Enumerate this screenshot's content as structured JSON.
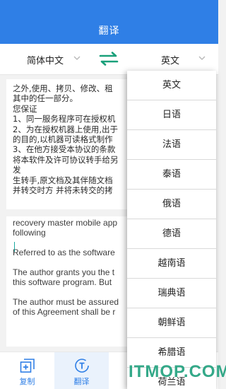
{
  "header": {
    "title": "翻译"
  },
  "language_bar": {
    "source_language": "简体中文",
    "target_language": "英文"
  },
  "source_panel": {
    "lines": [
      "之外,使用、拷贝、修改、租",
      "其中的任一部分。",
      "您保证",
      "1、同一服务程序可在授权机",
      "2、为在授权机器上使用,出于",
      "的目的,以机器可读格式制作",
      "3、在他方接受本协议的条款",
      "将本软件及许可协议转手给另",
      "发",
      "生转手,原文档及其伴随文档",
      "并转交时方 并将未转交的拷"
    ]
  },
  "target_panel": {
    "lines": [
      "recovery master mobile app",
      "following",
      "",
      "Referred to as the software",
      "",
      "The author grants you the t",
      "this software program. But",
      "",
      "The author must be assured",
      "of this Agreement shall be r"
    ]
  },
  "dropdown": {
    "options": [
      "英文",
      "日语",
      "法语",
      "泰语",
      "俄语",
      "德语",
      "越南语",
      "瑞典语",
      "朝鲜语",
      "希腊语",
      "荷兰语"
    ]
  },
  "bottom_tabs": [
    {
      "label": "复制",
      "icon": "copy-add-icon"
    },
    {
      "label": "翻译",
      "icon": "translate-icon"
    }
  ],
  "watermark": {
    "text": "ITMOP.COM"
  },
  "colors": {
    "header": "#2f7fe6",
    "swap_icon": "#1aa07a",
    "accent_tab": "#2f7fe6"
  }
}
